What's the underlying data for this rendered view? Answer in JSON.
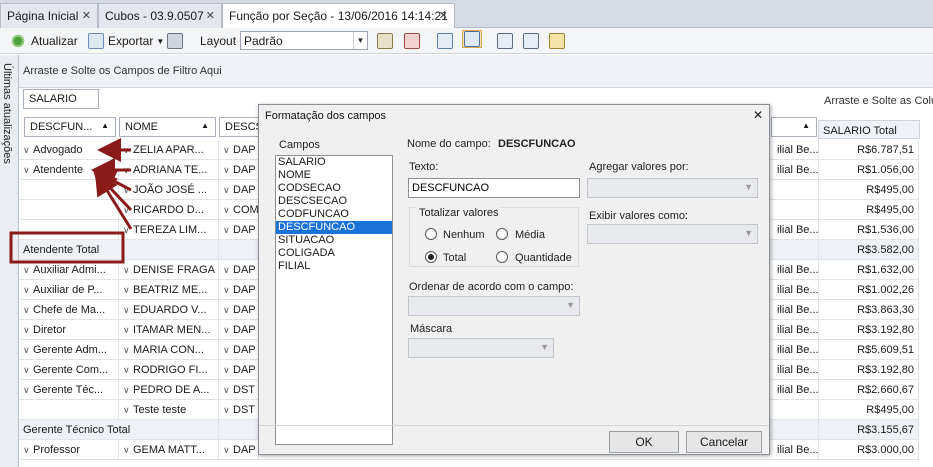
{
  "tabs": [
    {
      "label": "Página Inicial",
      "active": false
    },
    {
      "label": "Cubos - 03.9.0507",
      "active": false
    },
    {
      "label": "Função por Seção - 13/06/2016 14:14:21",
      "active": true
    }
  ],
  "toolbar": {
    "refresh_label": "Atualizar",
    "export_label": "Exportar",
    "layout_label": "Layout",
    "layout_value": "Padrão"
  },
  "side_tab_label": "Últimas atualizações",
  "grid": {
    "filter_hint": "Arraste e Solte os Campos de Filtro Aqui",
    "data_field": "SALARIO",
    "column_hint": "Arraste e Solte as Colu",
    "row_headers": {
      "descfuncao": "DESCFUN...",
      "nome": "NOME",
      "descsecao": "DESCS"
    },
    "salario_total_header": "SALARIO Total",
    "rows": [
      {
        "func": "Advogado",
        "nome": "ZELIA APAR...",
        "secao": "DAP",
        "right": "ilial Be...",
        "total": "R$6.787,51"
      },
      {
        "func": "Atendente",
        "nome": "ADRIANA TE...",
        "secao": "DAP",
        "right": "ilial Be...",
        "total": "R$1.056,00"
      },
      {
        "func": "",
        "nome": "JOÃO JOSÉ ...",
        "secao": "DAP",
        "right": "",
        "total": "R$495,00"
      },
      {
        "func": "",
        "nome": "RICARDO D...",
        "secao": "COM",
        "right": "",
        "total": "R$495,00"
      },
      {
        "func": "",
        "nome": "TEREZA LIM...",
        "secao": "DAP",
        "right": "ilial Be...",
        "total": "R$1.536,00"
      },
      {
        "func": "Atendente Total",
        "nome": "",
        "secao": "",
        "right": "",
        "total": "R$3.582,00",
        "is_total": true
      },
      {
        "func": "Auxiliar Admi...",
        "nome": "DENISE FRAGA",
        "secao": "DAP",
        "right": "ilial Be...",
        "total": "R$1.632,00"
      },
      {
        "func": "Auxiliar de P...",
        "nome": "BEATRIZ ME...",
        "secao": "DAP",
        "right": "ilial Be...",
        "total": "R$1.002,26"
      },
      {
        "func": "Chefe de Ma...",
        "nome": "EDUARDO V...",
        "secao": "DAP",
        "right": "ilial Be...",
        "total": "R$3.863,30"
      },
      {
        "func": "Diretor",
        "nome": "ITAMAR MEN...",
        "secao": "DAP",
        "right": "ilial Be...",
        "total": "R$3.192,80"
      },
      {
        "func": "Gerente Adm...",
        "nome": "MARIA CON...",
        "secao": "DAP",
        "right": "ilial Be...",
        "total": "R$5.609,51"
      },
      {
        "func": "Gerente Com...",
        "nome": "RODRIGO FI...",
        "secao": "DAP",
        "right": "ilial Be...",
        "total": "R$3.192,80"
      },
      {
        "func": "Gerente Téc...",
        "nome": "PEDRO DE A...",
        "secao": "DST",
        "right": "ilial Be...",
        "total": "R$2.660,67"
      },
      {
        "func": "",
        "nome": "Teste teste",
        "secao": "DST",
        "right": "",
        "total": "R$495,00"
      },
      {
        "func": "Gerente Técnico Total",
        "nome": "",
        "secao": "",
        "right": "",
        "total": "R$3.155,67",
        "is_total": true
      },
      {
        "func": "Professor",
        "nome": "GEMA MATT...",
        "secao": "DAP",
        "right": "ilial Be...",
        "total": "R$3.000,00"
      }
    ]
  },
  "dialog": {
    "title": "Formatação dos campos",
    "fields_label": "Campos",
    "fields": [
      "SALARIO",
      "NOME",
      "CODSECAO",
      "DESCSECAO",
      "CODFUNCAO",
      "DESCFUNCAO",
      "SITUACAO",
      "COLIGADA",
      "FILIAL"
    ],
    "selected_field": "DESCFUNCAO",
    "field_name_label": "Nome do campo:",
    "field_name_value": "DESCFUNCAO",
    "text_label": "Texto:",
    "text_value": "DESCFUNCAO",
    "aggregate_label": "Agregar valores por:",
    "display_label": "Exibir valores como:",
    "totalize_label": "Totalizar valores",
    "radios": [
      {
        "label": "Nenhum",
        "checked": false
      },
      {
        "label": "Média",
        "checked": false
      },
      {
        "label": "Total",
        "checked": true
      },
      {
        "label": "Quantidade",
        "checked": false
      }
    ],
    "order_label": "Ordenar de acordo com o campo:",
    "mask_label": "Máscara",
    "ok_label": "OK",
    "cancel_label": "Cancelar"
  },
  "colors": {
    "annotation": "#8b1a1a",
    "selection": "#1a73d9",
    "accent": "#2e6bc6"
  }
}
